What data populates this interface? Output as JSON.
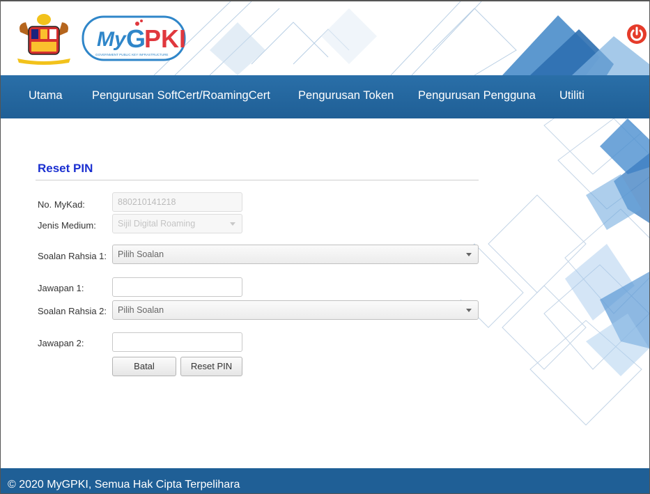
{
  "header": {
    "logo_text": "MyGPKI",
    "logo_subtitle": "GOVERNMENT PUBLIC KEY INFRASTRUCTURE",
    "crest_icon": "malaysia-coat-of-arms-icon",
    "power_icon": "power-icon",
    "power_color": "#e53b2a"
  },
  "nav": {
    "items": [
      {
        "label": "Utama"
      },
      {
        "label": "Pengurusan SoftCert/RoamingCert"
      },
      {
        "label": "Pengurusan Token"
      },
      {
        "label": "Pengurusan Pengguna"
      },
      {
        "label": "Utiliti"
      }
    ]
  },
  "form": {
    "title": "Reset PIN",
    "mykad_label": "No. MyKad:",
    "mykad_value": "880210141218",
    "medium_label": "Jenis Medium:",
    "medium_value": "Sijil Digital Roaming",
    "q1_label": "Soalan Rahsia 1:",
    "q1_value": "Pilih Soalan",
    "a1_label": "Jawapan 1:",
    "a1_value": "",
    "q2_label": "Soalan Rahsia 2:",
    "q2_value": "Pilih Soalan",
    "a2_label": "Jawapan 2:",
    "a2_value": "",
    "cancel_label": "Batal",
    "submit_label": "Reset PIN"
  },
  "footer": {
    "text": "© 2020 MyGPKI, Semua Hak Cipta Terpelihara"
  },
  "colors": {
    "nav_bg": "#2368a2",
    "footer_bg": "#1f5f96",
    "title_color": "#1a2fd0",
    "accent_blue": "#2f86c9"
  }
}
